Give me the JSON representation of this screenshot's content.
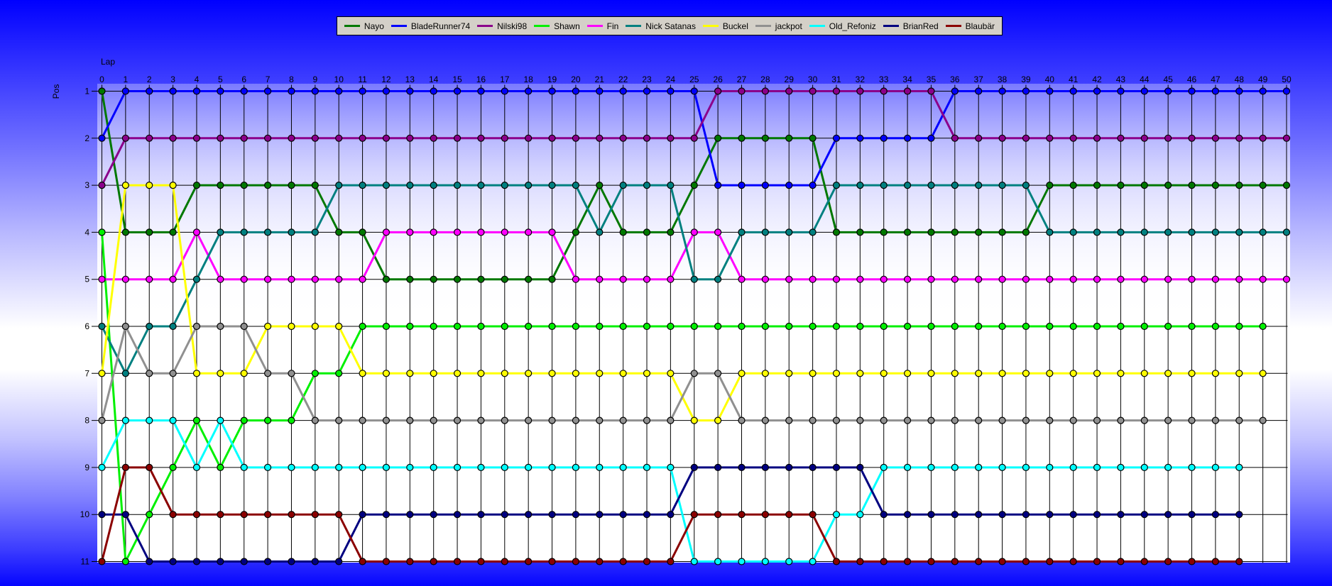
{
  "window": {
    "kind": "lap-position-chart"
  },
  "colors": {
    "background_blue": "#0000ff",
    "legend_background": "#d4d0c8",
    "grid": "#000000"
  },
  "chart_data": {
    "type": "line",
    "title": "",
    "xlabel": "Lap",
    "ylabel": "Pos",
    "xlim": [
      0,
      50
    ],
    "ylim": [
      1,
      11
    ],
    "grid": true,
    "legend_position": "top",
    "lap_ticks": [
      0,
      1,
      2,
      3,
      4,
      5,
      6,
      7,
      8,
      9,
      10,
      11,
      12,
      13,
      14,
      15,
      16,
      17,
      18,
      19,
      20,
      21,
      22,
      23,
      24,
      25,
      26,
      27,
      28,
      29,
      30,
      31,
      32,
      33,
      34,
      35,
      36,
      37,
      38,
      39,
      40,
      41,
      42,
      43,
      44,
      45,
      46,
      47,
      48,
      49,
      50
    ],
    "pos_ticks": [
      1,
      2,
      3,
      4,
      5,
      6,
      7,
      8,
      9,
      10,
      11
    ],
    "series": [
      {
        "name": "Nayo",
        "color": "#007800",
        "positions": [
          1,
          4,
          4,
          4,
          3,
          3,
          3,
          3,
          3,
          3,
          4,
          4,
          5,
          5,
          5,
          5,
          5,
          5,
          5,
          5,
          4,
          3,
          4,
          4,
          4,
          3,
          2,
          2,
          2,
          2,
          2,
          4,
          4,
          4,
          4,
          4,
          4,
          4,
          4,
          4,
          3,
          3,
          3,
          3,
          3,
          3,
          3,
          3,
          3,
          3,
          3
        ]
      },
      {
        "name": "BladeRunner74",
        "color": "#0000ff",
        "positions": [
          2,
          1,
          1,
          1,
          1,
          1,
          1,
          1,
          1,
          1,
          1,
          1,
          1,
          1,
          1,
          1,
          1,
          1,
          1,
          1,
          1,
          1,
          1,
          1,
          1,
          1,
          3,
          3,
          3,
          3,
          3,
          2,
          2,
          2,
          2,
          2,
          1,
          1,
          1,
          1,
          1,
          1,
          1,
          1,
          1,
          1,
          1,
          1,
          1,
          1,
          1
        ]
      },
      {
        "name": "Nilski98",
        "color": "#8b008b",
        "positions": [
          3,
          2,
          2,
          2,
          2,
          2,
          2,
          2,
          2,
          2,
          2,
          2,
          2,
          2,
          2,
          2,
          2,
          2,
          2,
          2,
          2,
          2,
          2,
          2,
          2,
          2,
          1,
          1,
          1,
          1,
          1,
          1,
          1,
          1,
          1,
          1,
          2,
          2,
          2,
          2,
          2,
          2,
          2,
          2,
          2,
          2,
          2,
          2,
          2,
          2,
          2
        ]
      },
      {
        "name": "Shawn",
        "color": "#00f000",
        "positions": [
          4,
          11,
          10,
          9,
          8,
          9,
          8,
          8,
          8,
          7,
          7,
          6,
          6,
          6,
          6,
          6,
          6,
          6,
          6,
          6,
          6,
          6,
          6,
          6,
          6,
          6,
          6,
          6,
          6,
          6,
          6,
          6,
          6,
          6,
          6,
          6,
          6,
          6,
          6,
          6,
          6,
          6,
          6,
          6,
          6,
          6,
          6,
          6,
          6,
          6
        ]
      },
      {
        "name": "Fin",
        "color": "#ff00ff",
        "positions": [
          5,
          5,
          5,
          5,
          4,
          5,
          5,
          5,
          5,
          5,
          5,
          5,
          4,
          4,
          4,
          4,
          4,
          4,
          4,
          4,
          5,
          5,
          5,
          5,
          5,
          4,
          4,
          5,
          5,
          5,
          5,
          5,
          5,
          5,
          5,
          5,
          5,
          5,
          5,
          5,
          5,
          5,
          5,
          5,
          5,
          5,
          5,
          5,
          5,
          5,
          5
        ]
      },
      {
        "name": "Nick Satanas",
        "color": "#008080",
        "positions": [
          6,
          7,
          6,
          6,
          5,
          4,
          4,
          4,
          4,
          4,
          3,
          3,
          3,
          3,
          3,
          3,
          3,
          3,
          3,
          3,
          3,
          4,
          3,
          3,
          3,
          5,
          5,
          4,
          4,
          4,
          4,
          3,
          3,
          3,
          3,
          3,
          3,
          3,
          3,
          3,
          4,
          4,
          4,
          4,
          4,
          4,
          4,
          4,
          4,
          4,
          4
        ]
      },
      {
        "name": "Buckel",
        "color": "#ffff00",
        "positions": [
          7,
          3,
          3,
          3,
          7,
          7,
          7,
          6,
          6,
          6,
          6,
          7,
          7,
          7,
          7,
          7,
          7,
          7,
          7,
          7,
          7,
          7,
          7,
          7,
          7,
          8,
          8,
          7,
          7,
          7,
          7,
          7,
          7,
          7,
          7,
          7,
          7,
          7,
          7,
          7,
          7,
          7,
          7,
          7,
          7,
          7,
          7,
          7,
          7,
          7
        ]
      },
      {
        "name": "jackpot",
        "color": "#909090",
        "positions": [
          8,
          6,
          7,
          7,
          6,
          6,
          6,
          7,
          7,
          8,
          8,
          8,
          8,
          8,
          8,
          8,
          8,
          8,
          8,
          8,
          8,
          8,
          8,
          8,
          8,
          7,
          7,
          8,
          8,
          8,
          8,
          8,
          8,
          8,
          8,
          8,
          8,
          8,
          8,
          8,
          8,
          8,
          8,
          8,
          8,
          8,
          8,
          8,
          8,
          8
        ]
      },
      {
        "name": "Old_Refoniz",
        "color": "#00ffff",
        "positions": [
          9,
          8,
          8,
          8,
          9,
          8,
          9,
          9,
          9,
          9,
          9,
          9,
          9,
          9,
          9,
          9,
          9,
          9,
          9,
          9,
          9,
          9,
          9,
          9,
          9,
          11,
          11,
          11,
          11,
          11,
          11,
          10,
          10,
          9,
          9,
          9,
          9,
          9,
          9,
          9,
          9,
          9,
          9,
          9,
          9,
          9,
          9,
          9,
          9
        ]
      },
      {
        "name": "BrianRed",
        "color": "#000080",
        "positions": [
          10,
          10,
          11,
          11,
          11,
          11,
          11,
          11,
          11,
          11,
          11,
          10,
          10,
          10,
          10,
          10,
          10,
          10,
          10,
          10,
          10,
          10,
          10,
          10,
          10,
          9,
          9,
          9,
          9,
          9,
          9,
          9,
          9,
          10,
          10,
          10,
          10,
          10,
          10,
          10,
          10,
          10,
          10,
          10,
          10,
          10,
          10,
          10,
          10
        ]
      },
      {
        "name": "Blaubär",
        "color": "#8b0000",
        "positions": [
          11,
          9,
          9,
          10,
          10,
          10,
          10,
          10,
          10,
          10,
          10,
          11,
          11,
          11,
          11,
          11,
          11,
          11,
          11,
          11,
          11,
          11,
          11,
          11,
          11,
          10,
          10,
          10,
          10,
          10,
          10,
          11,
          11,
          11,
          11,
          11,
          11,
          11,
          11,
          11,
          11,
          11,
          11,
          11,
          11,
          11,
          11,
          11,
          11
        ]
      }
    ]
  }
}
